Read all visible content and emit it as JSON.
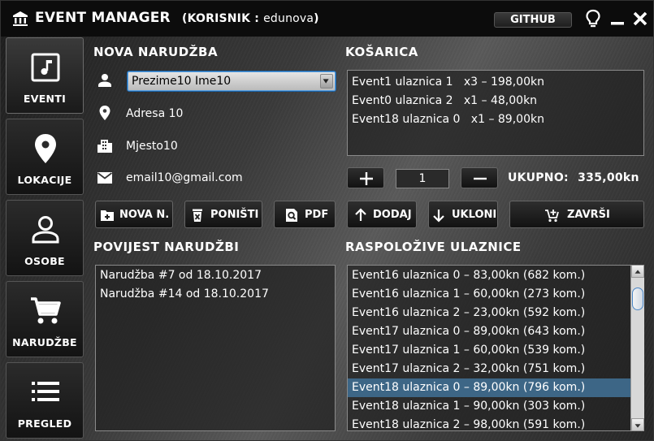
{
  "app": {
    "title": "EVENT MANAGER",
    "user_prefix": "(KORISNIK : ",
    "user_name": "edunova",
    "user_suffix": ")",
    "github_label": "GITHUB"
  },
  "sidebar": {
    "items": [
      {
        "label": "EVENTI",
        "icon": "music-note-icon"
      },
      {
        "label": "LOKACIJE",
        "icon": "location-pin-icon"
      },
      {
        "label": "OSOBE",
        "icon": "person-icon"
      },
      {
        "label": "NARUDŽBE",
        "icon": "shopping-cart-icon"
      },
      {
        "label": "PREGLED",
        "icon": "list-icon"
      }
    ]
  },
  "new_order": {
    "title": "NOVA NARUDŽBA",
    "customer": "Prezime10 Ime10",
    "address": "Adresa 10",
    "city": "Mjesto10",
    "email": "email10@gmail.com"
  },
  "cart": {
    "title": "KOŠARICA",
    "items": [
      "Event1 ulaznica 1   x3 – 198,00kn",
      "Event0 ulaznica 2   x1 – 48,00kn",
      "Event18 ulaznica 0   x1 – 89,00kn"
    ],
    "quantity": "1",
    "total_label": "UKUPNO:",
    "total_value": "335,00kn"
  },
  "buttons": {
    "new_order": "NOVA N.",
    "cancel": "PONIŠTI",
    "pdf": "PDF",
    "add": "DODAJ",
    "remove": "UKLONI",
    "finish": "ZAVRŠI",
    "plus": "+",
    "minus": "−"
  },
  "history": {
    "title": "POVIJEST NARUDŽBI",
    "items": [
      "Narudžba #7 od 18.10.2017",
      "Narudžba #14 od 18.10.2017"
    ]
  },
  "available": {
    "title": "RASPOLOŽIVE ULAZNICE",
    "selected_index": 6,
    "items": [
      "Event16 ulaznica 0 – 83,00kn (682 kom.)",
      "Event16 ulaznica 1 – 60,00kn (273 kom.)",
      "Event16 ulaznica 2 – 23,00kn (592 kom.)",
      "Event17 ulaznica 0 – 89,00kn (643 kom.)",
      "Event17 ulaznica 1 – 60,00kn (539 kom.)",
      "Event17 ulaznica 2 – 32,00kn (751 kom.)",
      "Event18 ulaznica 0 – 89,00kn (796 kom.)",
      "Event18 ulaznica 1 – 90,00kn (303 kom.)",
      "Event18 ulaznica 2 – 98,00kn (591 kom.)"
    ]
  },
  "colors": {
    "selection": "#3d6686",
    "select_border": "#1a63a8"
  }
}
